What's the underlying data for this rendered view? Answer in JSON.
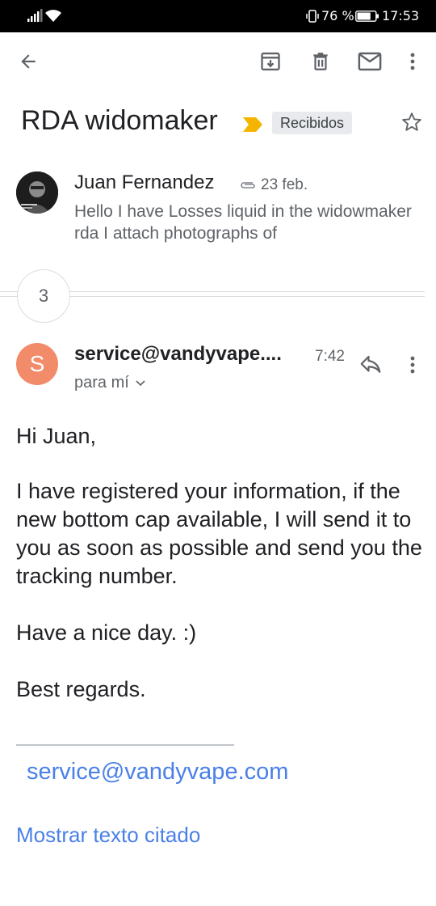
{
  "status_bar": {
    "battery_percent": "76 %",
    "time": "17:53",
    "battery_level": 0.76
  },
  "toolbar": {
    "icons": [
      "back-arrow-icon",
      "archive-icon",
      "delete-icon",
      "mail-icon",
      "more-vert-icon"
    ]
  },
  "thread": {
    "subject": "RDA widomaker",
    "label": "Recibidos",
    "label_color": "#f5b400"
  },
  "message1": {
    "sender": "Juan Fernandez",
    "date": "23 feb.",
    "snippet": "Hello I have Losses liquid in the widowmaker rda I attach photographs of"
  },
  "collapsed_count": "3",
  "message2": {
    "avatar_letter": "S",
    "avatar_color": "#f28b6a",
    "sender": "service@vandyvape....",
    "time": "7:42",
    "recipient": "para mí",
    "body": {
      "greeting": "Hi Juan,",
      "paragraph": "I have registered your information, if the new bottom cap available, I will send it to you as soon as possible and send you the tracking  number.",
      "wish": "Have a nice day. :)",
      "closing": "Best regards."
    },
    "signature_link": "service@vandyvape.com",
    "show_quoted": "Mostrar texto citado"
  },
  "colors": {
    "link": "#4a80e8",
    "secondary_text": "#5f6368"
  }
}
